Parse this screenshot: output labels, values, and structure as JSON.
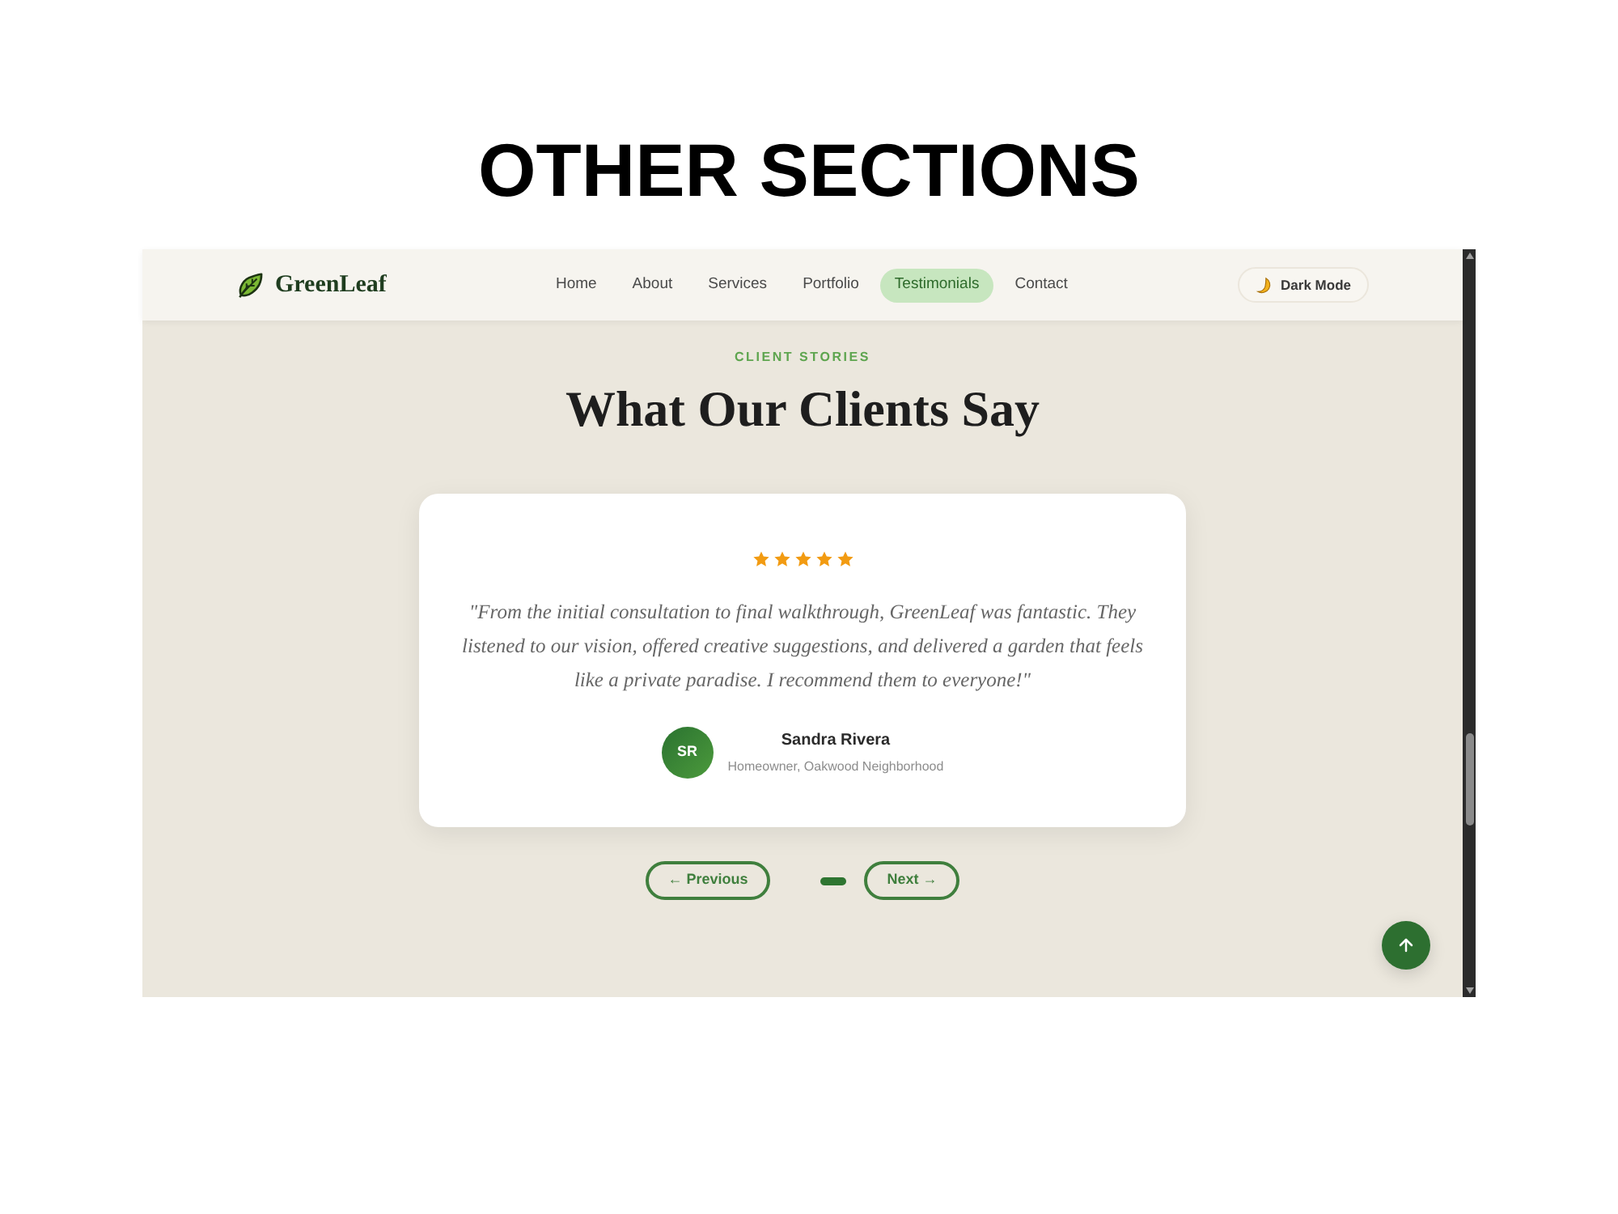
{
  "heading": "OTHER SECTIONS",
  "site": {
    "logo": "GreenLeaf",
    "nav": [
      {
        "label": "Home",
        "selected": false
      },
      {
        "label": "About",
        "selected": false
      },
      {
        "label": "Services",
        "selected": false
      },
      {
        "label": "Portfolio",
        "selected": false
      },
      {
        "label": "Testimonials",
        "selected": true
      },
      {
        "label": "Contact",
        "selected": false
      }
    ],
    "theme_toggle": "Dark Mode"
  },
  "testimonials": {
    "eyebrow": "CLIENT STORIES",
    "title": "What Our Clients Say",
    "card": {
      "stars": 5,
      "quote": "\"From the initial consultation to final walkthrough, GreenLeaf was fantastic. They listened to our vision, offered creative suggestions, and delivered a garden that feels like a private paradise. I recommend them to everyone!\"",
      "initials": "SR",
      "name": "Sandra Rivera",
      "role": "Homeowner, Oakwood Neighborhood"
    },
    "previous": "← Previous",
    "dots": [
      {
        "selected": true
      }
    ],
    "next": "Next →"
  }
}
